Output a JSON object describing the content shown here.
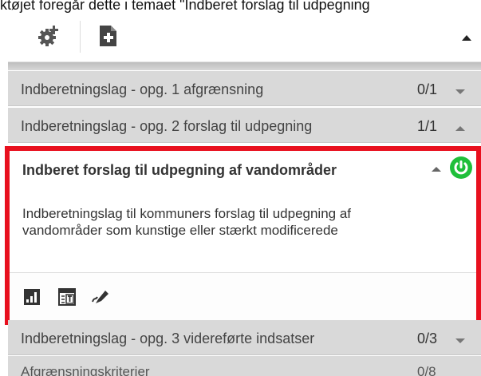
{
  "caption": "ktøjet foregår dette i temaet \"Indberet forslag til udpegning",
  "toolbar": {
    "settings_icon": "gear-plus-icon",
    "add_icon": "new-document-icon",
    "collapse_icon": "chevron-up-icon"
  },
  "layers": [
    {
      "label": "Indberetningslag - opg. 1 afgrænsning",
      "count": "0/1",
      "state": "collapsed"
    },
    {
      "label": "Indberetningslag - opg. 2 forslag til udpegning",
      "count": "1/1",
      "state": "expanded"
    },
    {
      "label": "Indberetningslag - opg. 3 videreførte indsatser",
      "count": "0/3",
      "state": "collapsed"
    },
    {
      "label": "Afgrænsningskriterier",
      "count": "0/8",
      "state": "collapsed"
    }
  ],
  "active_layer": {
    "title": "Indberet forslag til udpegning af vandområder",
    "description": "Indberetningslag til kommuners forslag til udpegning af vandområder som kunstige eller stærkt modificerede",
    "power_state": "on",
    "power_color": "#1fbf3a",
    "tools": [
      "bar-chart-icon",
      "attribute-table-icon",
      "edit-pencil-icon"
    ]
  },
  "colors": {
    "highlight_border": "#e8101e",
    "row_background": "#d9d9d9"
  }
}
